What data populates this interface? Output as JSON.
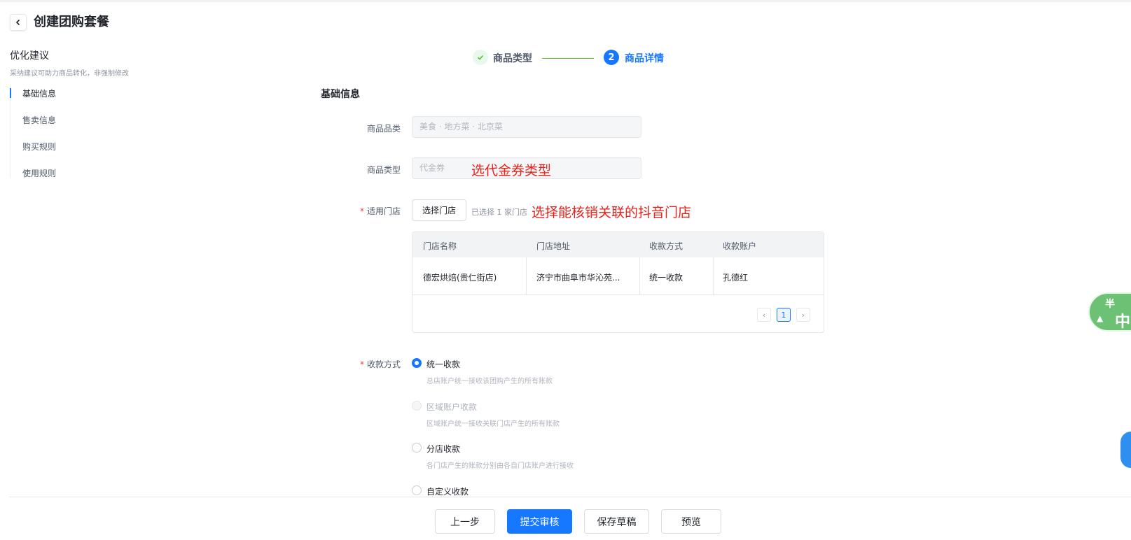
{
  "header": {
    "title": "创建团购套餐"
  },
  "aside": {
    "title": "优化建议",
    "subtitle": "采纳建议可助力商品转化，非强制修改",
    "items": [
      "基础信息",
      "售卖信息",
      "购买规则",
      "使用规则"
    ]
  },
  "steps": [
    {
      "label": "商品类型",
      "status": "done"
    },
    {
      "label": "商品详情",
      "status": "current",
      "number": "2"
    }
  ],
  "form": {
    "section_title": "基础信息",
    "category": {
      "label": "商品品类",
      "value": "美食 · 地方菜 · 北京菜"
    },
    "type": {
      "label": "商品类型",
      "value": "代金券",
      "annotation": "选代金券类型"
    },
    "stores": {
      "required_mark": "*",
      "label": "适用门店",
      "button": "选择门店",
      "count_text": "已选择 1 家门店",
      "annotation": "选择能核销关联的抖音门店",
      "table": {
        "columns": [
          "门店名称",
          "门店地址",
          "收款方式",
          "收款账户"
        ],
        "rows": [
          [
            "德宏烘焙(贵仁街店)",
            "济宁市曲阜市华沁苑...",
            "统一收款",
            "孔德红"
          ]
        ],
        "pagination": {
          "prev": "‹",
          "page": "1",
          "next": "›"
        }
      }
    },
    "payment": {
      "required_mark": "*",
      "label": "收款方式",
      "options": [
        {
          "label": "统一收款",
          "desc": "总店账户统一接收该团购产生的所有账款",
          "state": "checked"
        },
        {
          "label": "区域账户收款",
          "desc": "区域账户统一接收关联门店产生的所有账款",
          "state": "disabled"
        },
        {
          "label": "分店收款",
          "desc": "各门店产生的账款分别由各自门店账户进行接收",
          "state": "normal"
        },
        {
          "label": "自定义收款",
          "desc": "",
          "state": "normal"
        }
      ]
    }
  },
  "footer": {
    "prev": "上一步",
    "submit": "提交审核",
    "save_draft": "保存草稿",
    "preview": "预览"
  },
  "float_widget": {
    "line1": "半",
    "line2": "中"
  },
  "colors": {
    "primary": "#1677ff",
    "success": "#52c41a",
    "annotation": "#e8221a"
  }
}
